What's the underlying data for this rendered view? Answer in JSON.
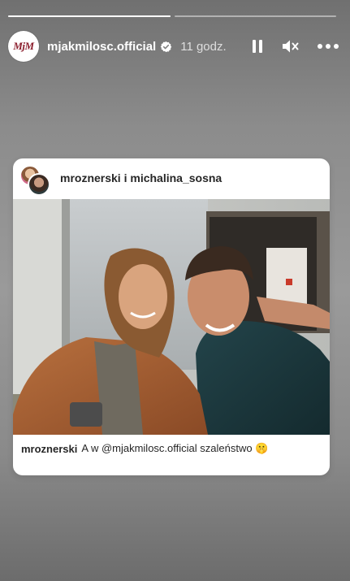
{
  "story": {
    "segments": [
      {
        "progress": 1.0
      },
      {
        "progress": 0.0
      }
    ],
    "account": {
      "avatar_text": "MjM",
      "username": "mjakmilosc.official",
      "time": "11 godz."
    },
    "controls": {
      "pause_icon": "pause-icon",
      "mute_icon": "muted-speaker-icon",
      "more_icon": "more-icon"
    }
  },
  "post": {
    "authors": "mroznerski i michalina_sosna",
    "caption_user": "mroznerski",
    "caption_text": "A w @mjakmilosc.official  szaleństwo 🤫",
    "photo_icon": "photo"
  },
  "colors": {
    "background_top": "#707070",
    "background_mid": "#9a9a9a",
    "card": "#ffffff",
    "text_dark": "#262626",
    "brand_maroon": "#8b1d2c"
  }
}
